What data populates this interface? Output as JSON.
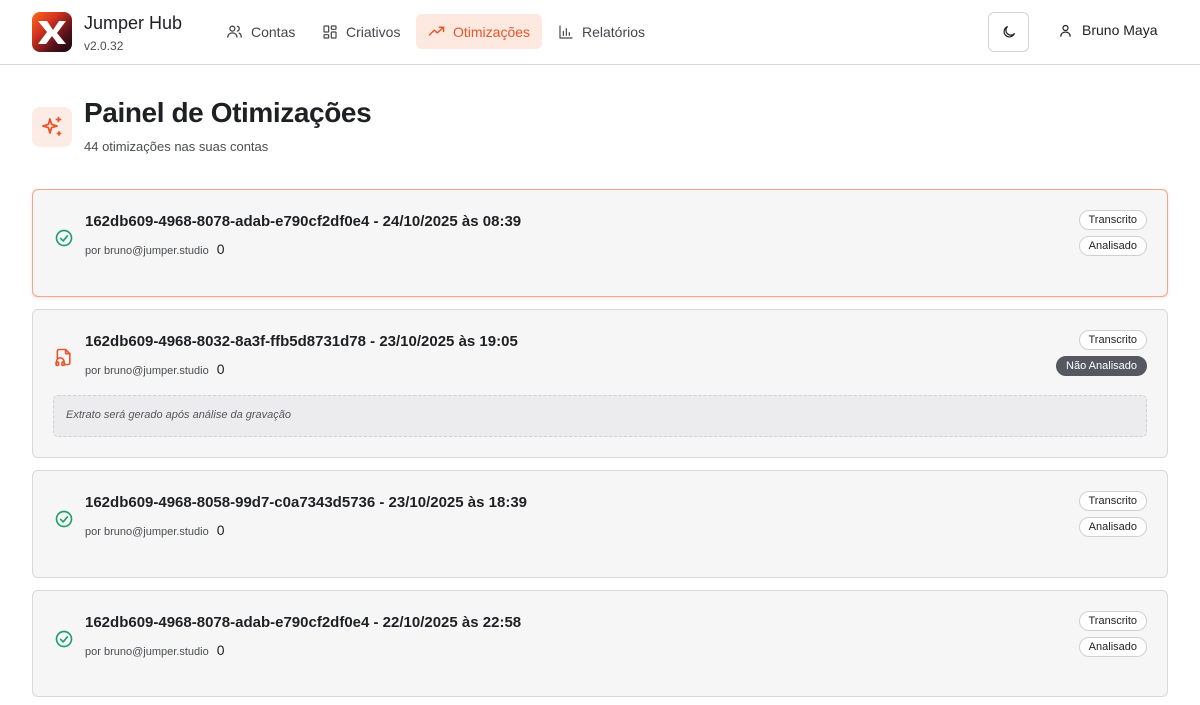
{
  "app": {
    "name": "Jumper Hub",
    "version": "v2.0.32"
  },
  "nav": {
    "items": [
      {
        "label": "Contas",
        "icon": "users-icon",
        "active": false
      },
      {
        "label": "Criativos",
        "icon": "grid-icon",
        "active": false
      },
      {
        "label": "Otimizações",
        "icon": "trending-up-icon",
        "active": true
      },
      {
        "label": "Relatórios",
        "icon": "bar-chart-icon",
        "active": false
      }
    ],
    "theme_toggle_icon": "moon-icon",
    "user_name": "Bruno Maya",
    "user_icon": "user-icon"
  },
  "page": {
    "icon": "sparkles-icon",
    "title": "Painel de Otimizações",
    "subtitle": "44 otimizações nas suas contas"
  },
  "optimizations": [
    {
      "title": "162db609-4968-8078-adab-e790cf2df0e4 - 24/10/2025 às 08:39",
      "author": "por bruno@jumper.studio",
      "count": "0",
      "status_icon": "check-circle-icon",
      "badges": [
        "Transcrito",
        "Analisado"
      ],
      "extract": ""
    },
    {
      "title": "162db609-4968-8032-8a3f-ffb5d8731d78 - 23/10/2025 às 19:05",
      "author": "por bruno@jumper.studio",
      "count": "0",
      "status_icon": "audio-file-icon",
      "badges": [
        "Transcrito",
        "Não Analisado"
      ],
      "extract": "Extrato será gerado após análise da gravação"
    },
    {
      "title": "162db609-4968-8058-99d7-c0a7343d5736 - 23/10/2025 às 18:39",
      "author": "por bruno@jumper.studio",
      "count": "0",
      "status_icon": "check-circle-icon",
      "badges": [
        "Transcrito",
        "Analisado"
      ],
      "extract": ""
    },
    {
      "title": "162db609-4968-8078-adab-e790cf2df0e4 - 22/10/2025 às 22:58",
      "author": "por bruno@jumper.studio",
      "count": "0",
      "status_icon": "check-circle-icon",
      "badges": [
        "Transcrito",
        "Analisado"
      ],
      "extract": ""
    }
  ],
  "colors": {
    "accent": "#e8552a",
    "accent_soft": "#fde9df",
    "success": "#22a06b",
    "badge_dark": "#555861"
  }
}
